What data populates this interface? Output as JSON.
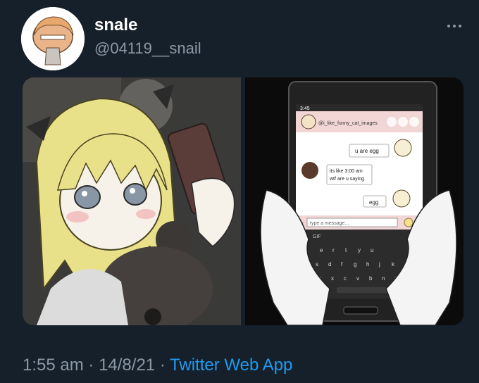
{
  "user": {
    "display_name": "snale",
    "handle": "@04119__snail"
  },
  "menu": {
    "icon": "more-dots-icon"
  },
  "phone": {
    "status_time": "3:45",
    "chat_username": "@i_like_funny_cat_images",
    "messages": [
      {
        "text": "u are egg"
      },
      {
        "text_line1": "its like 3:00 am",
        "text_line2": "wtf are u saying"
      },
      {
        "text": "egg"
      }
    ],
    "input_placeholder": "type a message...",
    "keyboard_row1": [
      "e",
      "r",
      "t",
      "y",
      "u"
    ],
    "keyboard_row2": [
      "s",
      "d",
      "f",
      "g",
      "h",
      "j",
      "k"
    ],
    "keyboard_row3": [
      "z",
      "x",
      "c",
      "v",
      "b",
      "n",
      "m"
    ],
    "gif_label": "GIF"
  },
  "tweet": {
    "time": "1:55 am",
    "separator": "·",
    "date": "14/8/21",
    "source": "Twitter Web App"
  },
  "colors": {
    "background": "#15202b",
    "secondary_text": "#8b98a5",
    "link": "#1d9bf0"
  }
}
